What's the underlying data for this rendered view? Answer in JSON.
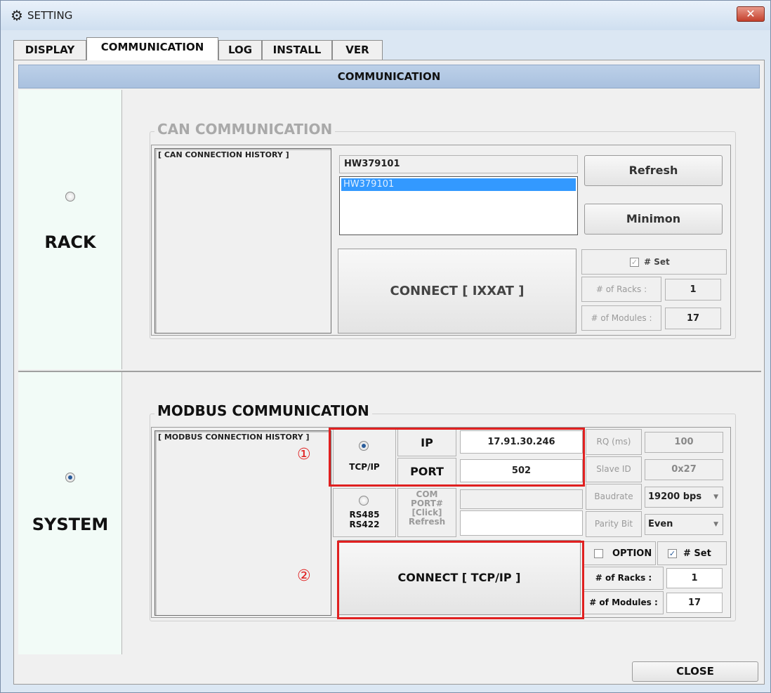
{
  "window": {
    "title": "SETTING",
    "close_glyph": "✕"
  },
  "tabs": [
    {
      "label": "DISPLAY",
      "active": false
    },
    {
      "label": "COMMUNICATION",
      "active": true
    },
    {
      "label": "LOG",
      "active": false
    },
    {
      "label": "INSTALL",
      "active": false
    },
    {
      "label": "VER",
      "active": false
    }
  ],
  "header": {
    "title": "COMMUNICATION"
  },
  "rack": {
    "label": "RACK",
    "selected": false,
    "group_title": "CAN COMMUNICATION",
    "history_label": "[ CAN CONNECTION HISTORY ]",
    "device_field": "HW379101",
    "device_list": [
      "HW379101"
    ],
    "refresh_label": "Refresh",
    "minimon_label": "Minimon",
    "connect_label": "CONNECT [ IXXAT ]",
    "set_label": "# Set",
    "set_checked": true,
    "racks_label": "# of Racks :",
    "racks_value": "1",
    "modules_label": "# of Modules :",
    "modules_value": "17"
  },
  "system": {
    "label": "SYSTEM",
    "selected": true,
    "group_title": "MODBUS COMMUNICATION",
    "history_label": "[ MODBUS CONNECTION HISTORY ]",
    "tcpip_label": "TCP/IP",
    "ip_label": "IP",
    "ip_value": "17.91.30.246",
    "port_label": "PORT",
    "port_value": "502",
    "rs_label_1": "RS485",
    "rs_label_2": "RS422",
    "com_label_1": "COM",
    "com_label_2": "PORT#",
    "com_label_3": "[Click]",
    "com_label_4": "Refresh",
    "rq_label": "RQ (ms)",
    "rq_value": "100",
    "slave_label": "Slave ID",
    "slave_value": "0x27",
    "baud_label": "Baudrate",
    "baud_value": "19200 bps",
    "parity_label": "Parity Bit",
    "parity_value": "Even",
    "connect_label": "CONNECT [ TCP/IP ]",
    "option_label": "OPTION",
    "option_checked": false,
    "set_label": "# Set",
    "set_checked": true,
    "racks_label": "# of Racks :",
    "racks_value": "1",
    "modules_label": "# of Modules :",
    "modules_value": "17"
  },
  "annotations": {
    "one": "①",
    "two": "②"
  },
  "footer": {
    "close_label": "CLOSE"
  }
}
